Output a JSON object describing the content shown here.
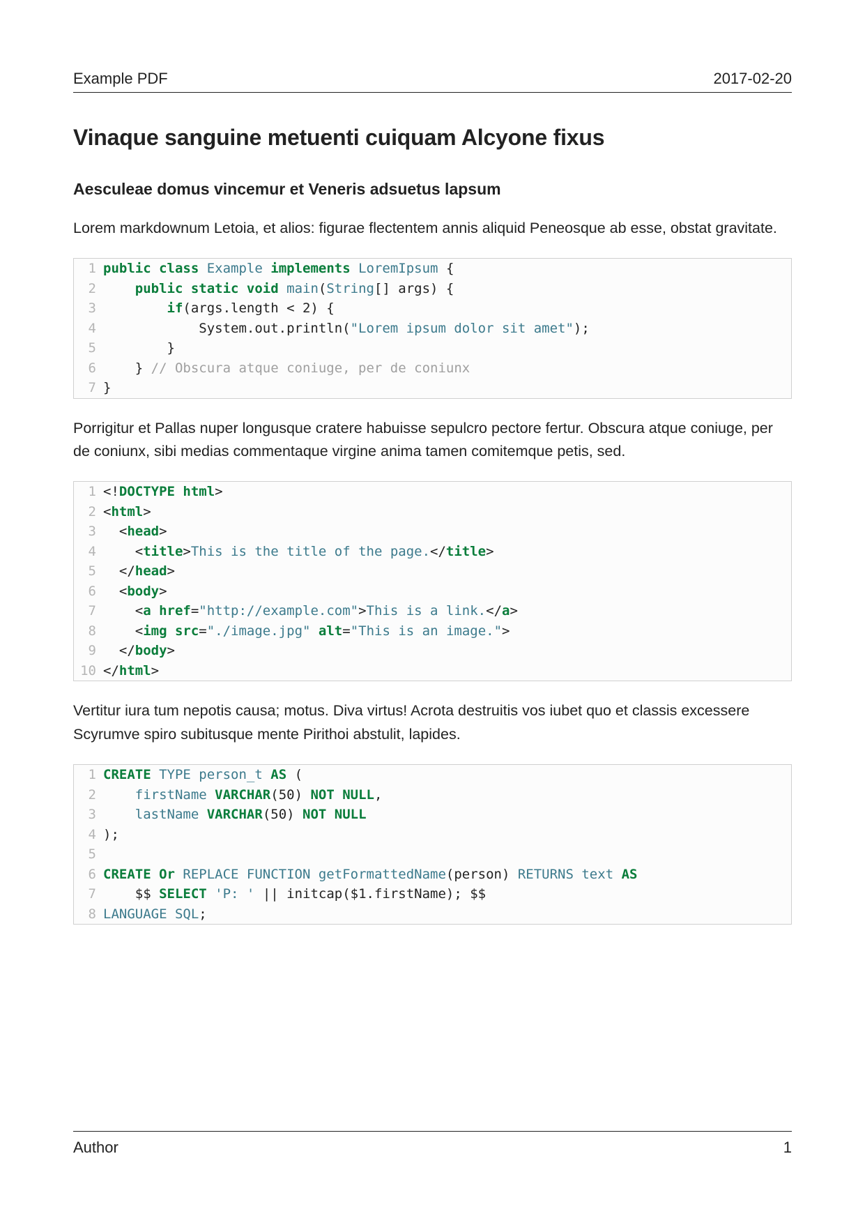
{
  "header": {
    "title_left": "Example PDF",
    "date_right": "2017-02-20"
  },
  "main_title": "Vinaque sanguine metuenti cuiquam Alcyone fixus",
  "sub_title": "Aesculeae domus vincemur et Veneris adsuetus lapsum",
  "para1": "Lorem markdownum Letoia, et alios: figurae flectentem annis aliquid Peneosque ab esse, obstat gravitate.",
  "code1": {
    "lines": [
      [
        {
          "cls": "tok-kw",
          "t": "public class"
        },
        {
          "cls": "",
          "t": " "
        },
        {
          "cls": "tok-type",
          "t": "Example"
        },
        {
          "cls": "",
          "t": " "
        },
        {
          "cls": "tok-kw",
          "t": "implements"
        },
        {
          "cls": "",
          "t": " "
        },
        {
          "cls": "tok-type",
          "t": "LoremIpsum"
        },
        {
          "cls": "",
          "t": " {"
        }
      ],
      [
        {
          "cls": "",
          "t": "    "
        },
        {
          "cls": "tok-kw",
          "t": "public static void"
        },
        {
          "cls": "",
          "t": " "
        },
        {
          "cls": "tok-fn",
          "t": "main"
        },
        {
          "cls": "",
          "t": "("
        },
        {
          "cls": "tok-type",
          "t": "String"
        },
        {
          "cls": "",
          "t": "[] args) {"
        }
      ],
      [
        {
          "cls": "",
          "t": "        "
        },
        {
          "cls": "tok-kw",
          "t": "if"
        },
        {
          "cls": "",
          "t": "(args.length < 2) {"
        }
      ],
      [
        {
          "cls": "",
          "t": "            System.out.println("
        },
        {
          "cls": "tok-str",
          "t": "\"Lorem ipsum dolor sit amet\""
        },
        {
          "cls": "",
          "t": ");"
        }
      ],
      [
        {
          "cls": "",
          "t": "        }"
        }
      ],
      [
        {
          "cls": "",
          "t": "    } "
        },
        {
          "cls": "tok-cmt",
          "t": "// Obscura atque coniuge, per de coniunx"
        }
      ],
      [
        {
          "cls": "",
          "t": "}"
        }
      ]
    ]
  },
  "para2": "Porrigitur et Pallas nuper longusque cratere habuisse sepulcro pectore fertur. Obscura atque coniuge, per de coniunx, sibi medias commentaque virgine anima tamen comitemque petis, sed.",
  "code2": {
    "lines": [
      [
        {
          "cls": "",
          "t": "<!"
        },
        {
          "cls": "tok-kw",
          "t": "DOCTYPE html"
        },
        {
          "cls": "",
          "t": ">"
        }
      ],
      [
        {
          "cls": "",
          "t": "<"
        },
        {
          "cls": "tok-kw",
          "t": "html"
        },
        {
          "cls": "",
          "t": ">"
        }
      ],
      [
        {
          "cls": "",
          "t": "  <"
        },
        {
          "cls": "tok-kw",
          "t": "head"
        },
        {
          "cls": "",
          "t": ">"
        }
      ],
      [
        {
          "cls": "",
          "t": "    <"
        },
        {
          "cls": "tok-kw",
          "t": "title"
        },
        {
          "cls": "",
          "t": ">"
        },
        {
          "cls": "tok-type",
          "t": "This is the title of the page."
        },
        {
          "cls": "",
          "t": "</"
        },
        {
          "cls": "tok-kw",
          "t": "title"
        },
        {
          "cls": "",
          "t": ">"
        }
      ],
      [
        {
          "cls": "",
          "t": "  </"
        },
        {
          "cls": "tok-kw",
          "t": "head"
        },
        {
          "cls": "",
          "t": ">"
        }
      ],
      [
        {
          "cls": "",
          "t": "  <"
        },
        {
          "cls": "tok-kw",
          "t": "body"
        },
        {
          "cls": "",
          "t": ">"
        }
      ],
      [
        {
          "cls": "",
          "t": "    <"
        },
        {
          "cls": "tok-kw",
          "t": "a href"
        },
        {
          "cls": "",
          "t": "="
        },
        {
          "cls": "tok-str",
          "t": "\"http://example.com\""
        },
        {
          "cls": "",
          "t": ">"
        },
        {
          "cls": "tok-type",
          "t": "This is a link."
        },
        {
          "cls": "",
          "t": "</"
        },
        {
          "cls": "tok-kw",
          "t": "a"
        },
        {
          "cls": "",
          "t": ">"
        }
      ],
      [
        {
          "cls": "",
          "t": "    <"
        },
        {
          "cls": "tok-kw",
          "t": "img src"
        },
        {
          "cls": "",
          "t": "="
        },
        {
          "cls": "tok-str",
          "t": "\"./image.jpg\""
        },
        {
          "cls": "",
          "t": " "
        },
        {
          "cls": "tok-kw",
          "t": "alt"
        },
        {
          "cls": "",
          "t": "="
        },
        {
          "cls": "tok-str",
          "t": "\"This is an image.\""
        },
        {
          "cls": "",
          "t": ">"
        }
      ],
      [
        {
          "cls": "",
          "t": "  </"
        },
        {
          "cls": "tok-kw",
          "t": "body"
        },
        {
          "cls": "",
          "t": ">"
        }
      ],
      [
        {
          "cls": "",
          "t": "</"
        },
        {
          "cls": "tok-kw",
          "t": "html"
        },
        {
          "cls": "",
          "t": ">"
        }
      ]
    ]
  },
  "para3": "Vertitur iura tum nepotis causa; motus. Diva virtus! Acrota destruitis vos iubet quo et classis excessere Scyrumve spiro subitusque mente Pirithoi abstulit, lapides.",
  "code3": {
    "lines": [
      [
        {
          "cls": "tok-kw",
          "t": "CREATE"
        },
        {
          "cls": "",
          "t": " "
        },
        {
          "cls": "tok-type",
          "t": "TYPE person_t"
        },
        {
          "cls": "",
          "t": " "
        },
        {
          "cls": "tok-kw",
          "t": "AS"
        },
        {
          "cls": "",
          "t": " ("
        }
      ],
      [
        {
          "cls": "",
          "t": "    "
        },
        {
          "cls": "tok-type",
          "t": "firstName"
        },
        {
          "cls": "",
          "t": " "
        },
        {
          "cls": "tok-kw",
          "t": "VARCHAR"
        },
        {
          "cls": "",
          "t": "(50) "
        },
        {
          "cls": "tok-kw",
          "t": "NOT NULL"
        },
        {
          "cls": "",
          "t": ","
        }
      ],
      [
        {
          "cls": "",
          "t": "    "
        },
        {
          "cls": "tok-type",
          "t": "lastName"
        },
        {
          "cls": "",
          "t": " "
        },
        {
          "cls": "tok-kw",
          "t": "VARCHAR"
        },
        {
          "cls": "",
          "t": "(50) "
        },
        {
          "cls": "tok-kw",
          "t": "NOT NULL"
        }
      ],
      [
        {
          "cls": "",
          "t": ");"
        }
      ],
      [
        {
          "cls": "",
          "t": " "
        }
      ],
      [
        {
          "cls": "tok-kw",
          "t": "CREATE Or"
        },
        {
          "cls": "",
          "t": " "
        },
        {
          "cls": "tok-type",
          "t": "REPLACE FUNCTION getFormattedName"
        },
        {
          "cls": "",
          "t": "(person) "
        },
        {
          "cls": "tok-type",
          "t": "RETURNS text"
        },
        {
          "cls": "",
          "t": " "
        },
        {
          "cls": "tok-kw",
          "t": "AS"
        }
      ],
      [
        {
          "cls": "",
          "t": "    $$ "
        },
        {
          "cls": "tok-kw",
          "t": "SELECT"
        },
        {
          "cls": "",
          "t": " "
        },
        {
          "cls": "tok-str",
          "t": "'P: '"
        },
        {
          "cls": "",
          "t": " || initcap($1.firstName); $$"
        }
      ],
      [
        {
          "cls": "tok-type",
          "t": "LANGUAGE SQL"
        },
        {
          "cls": "",
          "t": ";"
        }
      ]
    ]
  },
  "footer": {
    "author": "Author",
    "page": "1"
  }
}
